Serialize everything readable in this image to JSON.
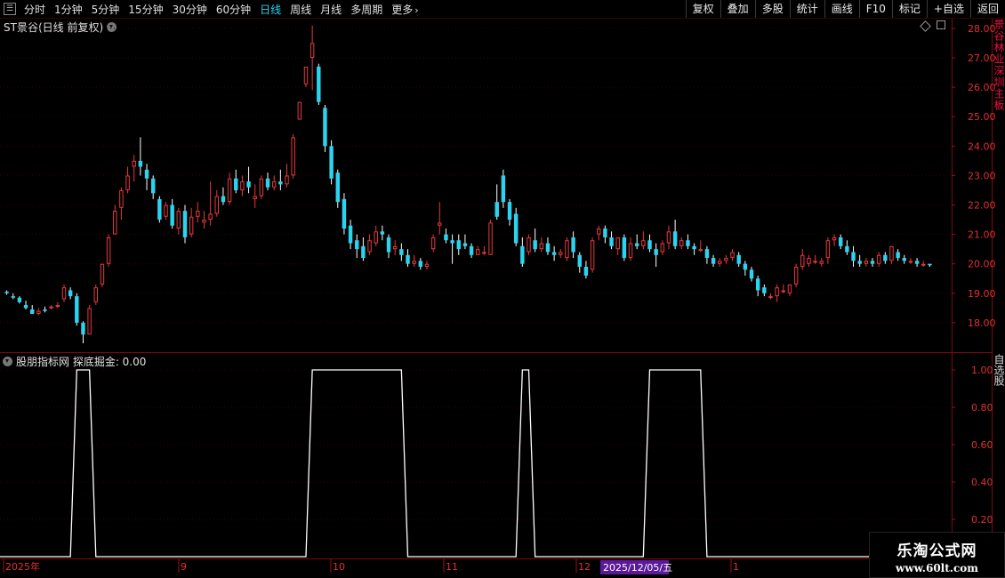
{
  "toolbar": {
    "periods": [
      "分时",
      "1分钟",
      "5分钟",
      "15分钟",
      "30分钟",
      "60分钟",
      "日线",
      "周线",
      "月线",
      "多周期",
      "更多"
    ],
    "active_period": "日线",
    "right_tools": [
      "复权",
      "叠加",
      "多股",
      "统计",
      "画线",
      "F10",
      "标记",
      "+自选",
      "返回"
    ]
  },
  "main_chart": {
    "title": "ST景谷(日线 前复权)",
    "price_labels": [
      "28.00",
      "27.00",
      "26.00",
      "25.00",
      "24.00",
      "23.00",
      "22.00",
      "21.00",
      "20.00",
      "19.00",
      "18.00"
    ],
    "up_color": "#e8383d",
    "down_color": "#2ad4f0"
  },
  "indicator": {
    "title": "股朋指标网 探底掘金: 0.00",
    "y_labels": [
      "1.00",
      "0.80",
      "0.60",
      "0.40",
      "0.20"
    ]
  },
  "time_axis": {
    "labels": [
      "2025年",
      "9",
      "10",
      "11",
      "12",
      "1"
    ],
    "cursor_date": "2025/12/05/五"
  },
  "side_panel": {
    "top_text": "景谷林业深圳主板",
    "bottom_text": "自选股"
  },
  "watermark": {
    "title": "乐淘公式网",
    "url": "www.60lt.com"
  },
  "chart_data": {
    "type": "candlestick",
    "ylim": [
      17.0,
      28.3
    ],
    "indicator_ylim": [
      0,
      1
    ],
    "candles": [
      [
        19.05,
        19.1,
        19.0,
        18.95
      ],
      [
        18.9,
        19.0,
        18.85,
        18.8
      ],
      [
        18.85,
        18.9,
        18.7,
        18.65
      ],
      [
        18.6,
        18.75,
        18.5,
        18.45
      ],
      [
        18.45,
        18.6,
        18.3,
        18.3
      ],
      [
        18.3,
        18.5,
        18.4,
        18.25
      ],
      [
        18.45,
        18.55,
        18.4,
        18.35
      ],
      [
        18.5,
        18.6,
        18.55,
        18.45
      ],
      [
        18.55,
        18.7,
        18.6,
        18.5
      ],
      [
        18.8,
        19.3,
        19.2,
        18.7
      ],
      [
        19.1,
        19.2,
        18.9,
        18.8
      ],
      [
        18.9,
        19.0,
        18.0,
        17.9
      ],
      [
        18.0,
        18.05,
        17.6,
        17.3
      ],
      [
        17.6,
        18.6,
        18.5,
        17.6
      ],
      [
        18.7,
        19.3,
        19.2,
        18.6
      ],
      [
        19.3,
        20.0,
        20.0,
        19.2
      ],
      [
        20.0,
        21.0,
        20.9,
        19.9
      ],
      [
        21.0,
        22.0,
        21.8,
        21.0
      ],
      [
        21.9,
        22.6,
        22.5,
        21.5
      ],
      [
        22.5,
        23.3,
        23.0,
        22.4
      ],
      [
        23.3,
        23.7,
        23.5,
        22.8
      ],
      [
        23.5,
        24.3,
        23.3,
        23.0
      ],
      [
        23.2,
        23.4,
        22.9,
        22.5
      ],
      [
        22.9,
        23.0,
        22.4,
        22.2
      ],
      [
        22.2,
        22.3,
        21.5,
        21.4
      ],
      [
        21.6,
        22.1,
        22.0,
        21.5
      ],
      [
        22.0,
        22.2,
        21.3,
        21.2
      ],
      [
        21.2,
        21.9,
        21.8,
        21.0
      ],
      [
        21.8,
        22.0,
        20.9,
        20.7
      ],
      [
        21.0,
        21.9,
        21.6,
        20.9
      ],
      [
        21.6,
        22.1,
        21.8,
        21.4
      ],
      [
        21.4,
        21.8,
        21.5,
        21.2
      ],
      [
        21.5,
        22.8,
        21.7,
        21.3
      ],
      [
        21.7,
        22.5,
        22.3,
        21.6
      ],
      [
        22.3,
        22.6,
        22.1,
        22.0
      ],
      [
        22.1,
        23.1,
        22.9,
        22.0
      ],
      [
        22.9,
        23.2,
        22.5,
        22.4
      ],
      [
        22.5,
        23.0,
        22.8,
        22.3
      ],
      [
        22.8,
        23.3,
        22.6,
        22.4
      ],
      [
        22.2,
        22.7,
        22.3,
        21.9
      ],
      [
        22.3,
        23.0,
        22.9,
        22.2
      ],
      [
        22.9,
        23.1,
        22.6,
        22.5
      ],
      [
        22.6,
        23.0,
        22.8,
        22.5
      ],
      [
        22.8,
        23.2,
        22.7,
        22.5
      ],
      [
        22.7,
        23.4,
        23.0,
        22.6
      ],
      [
        23.0,
        24.4,
        24.3,
        22.9
      ],
      [
        24.9,
        25.5,
        25.5,
        24.9
      ],
      [
        26.1,
        26.7,
        26.7,
        26.0
      ],
      [
        27.0,
        28.1,
        27.5,
        25.9
      ],
      [
        26.7,
        26.8,
        25.5,
        25.4
      ],
      [
        25.3,
        25.4,
        24.0,
        23.8
      ],
      [
        24.0,
        24.2,
        22.9,
        22.7
      ],
      [
        23.1,
        23.2,
        22.1,
        21.9
      ],
      [
        22.2,
        22.4,
        21.2,
        21.0
      ],
      [
        21.3,
        21.5,
        20.7,
        20.5
      ],
      [
        20.8,
        21.0,
        20.5,
        20.2
      ],
      [
        20.6,
        20.9,
        20.2,
        20.1
      ],
      [
        20.4,
        21.0,
        20.8,
        20.3
      ],
      [
        20.7,
        21.3,
        21.1,
        20.6
      ],
      [
        21.1,
        21.3,
        21.0,
        20.8
      ],
      [
        20.9,
        21.0,
        20.4,
        20.2
      ],
      [
        20.5,
        20.8,
        20.6,
        20.3
      ],
      [
        20.5,
        20.7,
        20.3,
        20.1
      ],
      [
        20.3,
        20.5,
        20.0,
        19.9
      ],
      [
        20.0,
        20.3,
        20.1,
        19.9
      ],
      [
        20.1,
        20.2,
        19.9,
        19.8
      ],
      [
        19.9,
        20.1,
        20.0,
        19.8
      ],
      [
        20.5,
        21.0,
        20.9,
        20.4
      ],
      [
        21.3,
        22.1,
        21.4,
        21.0
      ],
      [
        21.0,
        21.2,
        20.8,
        20.7
      ],
      [
        20.8,
        21.0,
        20.7,
        20.0
      ],
      [
        20.8,
        21.0,
        20.5,
        20.3
      ],
      [
        20.7,
        21.0,
        20.6,
        20.5
      ],
      [
        20.6,
        20.7,
        20.3,
        20.2
      ],
      [
        20.3,
        20.6,
        20.5,
        20.3
      ],
      [
        20.4,
        20.6,
        20.4,
        20.3
      ],
      [
        20.3,
        21.5,
        21.4,
        20.3
      ],
      [
        22.1,
        22.7,
        21.6,
        21.5
      ],
      [
        23.0,
        23.2,
        22.1,
        21.9
      ],
      [
        22.1,
        22.2,
        21.5,
        21.3
      ],
      [
        21.7,
        21.9,
        20.7,
        20.6
      ],
      [
        20.6,
        20.9,
        20.0,
        19.9
      ],
      [
        20.4,
        21.0,
        20.9,
        20.3
      ],
      [
        20.8,
        21.2,
        20.5,
        20.4
      ],
      [
        20.5,
        20.9,
        20.7,
        20.4
      ],
      [
        20.7,
        20.9,
        20.4,
        20.3
      ],
      [
        20.4,
        20.6,
        20.3,
        20.1
      ],
      [
        20.3,
        20.5,
        20.4,
        20.2
      ],
      [
        20.2,
        20.9,
        20.8,
        20.1
      ],
      [
        20.9,
        21.1,
        20.4,
        20.2
      ],
      [
        20.3,
        20.4,
        19.9,
        19.7
      ],
      [
        19.9,
        20.1,
        19.6,
        19.5
      ],
      [
        19.8,
        20.9,
        20.8,
        19.7
      ],
      [
        21.0,
        21.3,
        21.2,
        20.8
      ],
      [
        21.2,
        21.3,
        20.9,
        20.7
      ],
      [
        20.9,
        21.1,
        20.6,
        20.5
      ],
      [
        20.5,
        20.9,
        20.9,
        20.3
      ],
      [
        20.9,
        21.0,
        20.2,
        20.1
      ],
      [
        20.2,
        20.9,
        20.7,
        20.1
      ],
      [
        20.7,
        21.0,
        20.6,
        20.5
      ],
      [
        20.6,
        21.1,
        20.8,
        20.5
      ],
      [
        20.8,
        21.0,
        20.5,
        20.4
      ],
      [
        20.5,
        20.7,
        20.3,
        19.9
      ],
      [
        20.4,
        20.8,
        20.7,
        20.3
      ],
      [
        20.7,
        21.3,
        21.1,
        20.5
      ],
      [
        21.1,
        21.5,
        20.6,
        20.5
      ],
      [
        20.6,
        20.9,
        20.8,
        20.5
      ],
      [
        20.8,
        21.0,
        20.6,
        20.5
      ],
      [
        20.6,
        20.7,
        20.5,
        20.3
      ],
      [
        20.5,
        20.8,
        20.5,
        20.4
      ],
      [
        20.5,
        20.6,
        20.2,
        20.0
      ],
      [
        20.2,
        20.3,
        20.0,
        19.9
      ],
      [
        20.0,
        20.2,
        20.1,
        19.9
      ],
      [
        20.1,
        20.3,
        20.2,
        20.0
      ],
      [
        20.2,
        20.5,
        20.4,
        20.1
      ],
      [
        20.3,
        20.4,
        20.0,
        19.9
      ],
      [
        20.0,
        20.1,
        19.8,
        19.6
      ],
      [
        19.8,
        19.9,
        19.5,
        19.4
      ],
      [
        19.5,
        19.6,
        19.1,
        18.9
      ],
      [
        19.2,
        19.3,
        19.0,
        18.9
      ],
      [
        18.9,
        19.0,
        18.9,
        18.8
      ],
      [
        18.9,
        19.3,
        19.2,
        18.7
      ],
      [
        19.1,
        19.3,
        19.1,
        19.0
      ],
      [
        19.0,
        19.3,
        19.3,
        18.9
      ],
      [
        19.3,
        20.0,
        19.9,
        19.2
      ],
      [
        19.9,
        20.5,
        20.3,
        19.8
      ],
      [
        20.0,
        20.3,
        20.2,
        19.9
      ],
      [
        20.1,
        20.3,
        20.1,
        20.0
      ],
      [
        20.0,
        20.2,
        20.1,
        19.9
      ],
      [
        20.2,
        20.9,
        20.8,
        20.0
      ],
      [
        20.8,
        21.0,
        20.9,
        20.6
      ],
      [
        20.9,
        21.0,
        20.6,
        20.5
      ],
      [
        20.6,
        20.8,
        20.4,
        20.3
      ],
      [
        20.4,
        20.6,
        20.1,
        19.9
      ],
      [
        20.1,
        20.3,
        20.0,
        19.9
      ],
      [
        20.0,
        20.2,
        20.1,
        19.9
      ],
      [
        20.1,
        20.2,
        20.0,
        19.9
      ],
      [
        20.0,
        20.4,
        20.3,
        19.9
      ],
      [
        20.3,
        20.4,
        20.1,
        20.0
      ],
      [
        20.1,
        20.6,
        20.6,
        20.0
      ],
      [
        20.4,
        20.5,
        20.2,
        20.1
      ],
      [
        20.2,
        20.3,
        20.1,
        20.0
      ],
      [
        20.1,
        20.2,
        20.1,
        20.0
      ],
      [
        20.1,
        20.2,
        20.0,
        19.9
      ],
      [
        20.0,
        20.1,
        20.0,
        19.9
      ],
      [
        20.0,
        20.0,
        19.95,
        19.9
      ]
    ],
    "indicator_segments": [
      [
        0,
        0
      ],
      [
        10,
        0
      ],
      [
        11,
        1
      ],
      [
        13,
        1
      ],
      [
        14,
        0
      ],
      [
        47,
        0
      ],
      [
        48,
        1
      ],
      [
        62,
        1
      ],
      [
        63,
        0
      ],
      [
        80,
        0
      ],
      [
        81,
        1
      ],
      [
        82,
        1
      ],
      [
        83,
        0
      ],
      [
        100,
        0
      ],
      [
        101,
        1
      ],
      [
        109,
        1
      ],
      [
        110,
        0
      ],
      [
        125,
        0
      ]
    ]
  }
}
